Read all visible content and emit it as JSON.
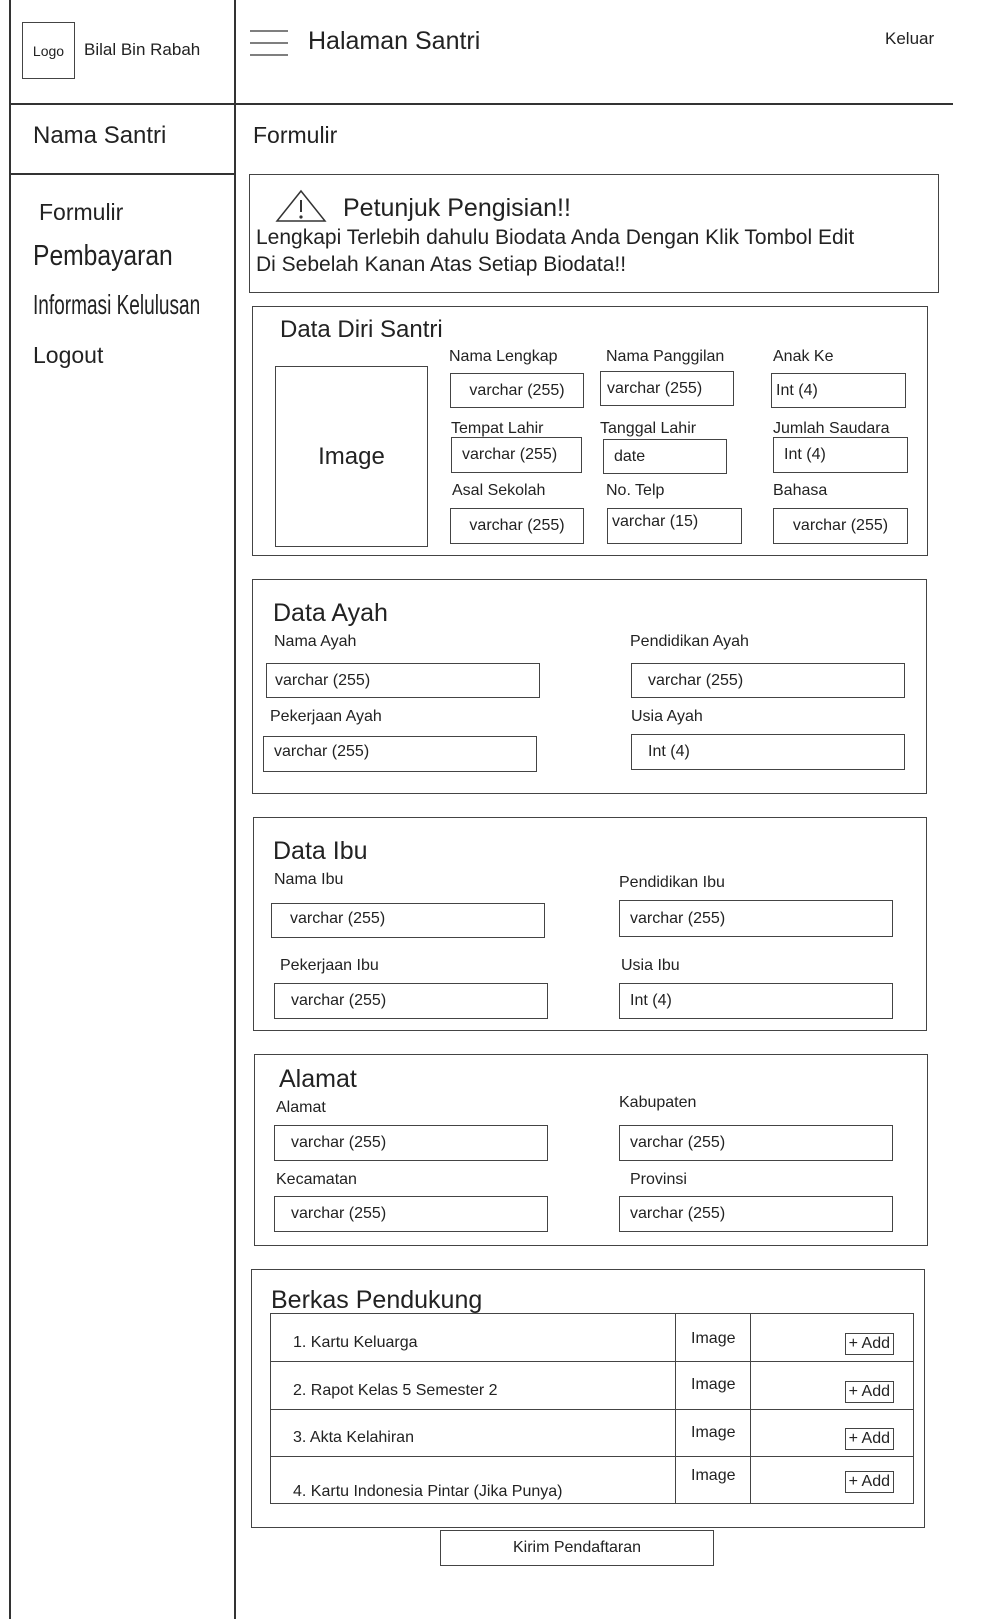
{
  "header": {
    "logo": "Logo",
    "brand": "Bilal Bin Rabah",
    "menu_icon": "hamburger-menu-icon",
    "page_title": "Halaman Santri",
    "logout_link": "Keluar"
  },
  "sidebar": {
    "user_name": "Nama Santri",
    "items": [
      {
        "label": "Formulir"
      },
      {
        "label": "Pembayaran"
      },
      {
        "label": "Informasi Kelulusan"
      },
      {
        "label": "Logout"
      }
    ]
  },
  "main": {
    "title": "Formulir",
    "notice": {
      "icon": "warning-triangle-icon",
      "heading": "Petunjuk Pengisian!!",
      "line1": "Lengkapi Terlebih dahulu Biodata Anda Dengan Klik Tombol Edit",
      "line2": "Di Sebelah Kanan Atas Setiap Biodata!!"
    },
    "data_diri": {
      "title": "Data Diri Santri",
      "photo": "Image",
      "fields": [
        {
          "label": "Nama Lengkap",
          "value": "varchar (255)"
        },
        {
          "label": "Nama Panggilan",
          "value": "varchar (255)"
        },
        {
          "label": "Anak Ke",
          "value": "Int (4)"
        },
        {
          "label": "Tempat Lahir",
          "value": "varchar (255)"
        },
        {
          "label": "Tanggal Lahir",
          "value": "date"
        },
        {
          "label": "Jumlah Saudara",
          "value": "Int (4)"
        },
        {
          "label": "Asal Sekolah",
          "value": "varchar (255)"
        },
        {
          "label": "No. Telp",
          "value": "varchar (15)"
        },
        {
          "label": "Bahasa",
          "value": "varchar (255)"
        }
      ]
    },
    "data_ayah": {
      "title": "Data Ayah",
      "fields": [
        {
          "label": "Nama Ayah",
          "value": "varchar (255)"
        },
        {
          "label": "Pendidikan Ayah",
          "value": "varchar (255)"
        },
        {
          "label": "Pekerjaan Ayah",
          "value": "varchar (255)"
        },
        {
          "label": "Usia Ayah",
          "value": "Int (4)"
        }
      ]
    },
    "data_ibu": {
      "title": "Data Ibu",
      "fields": [
        {
          "label": "Nama Ibu",
          "value": "varchar (255)"
        },
        {
          "label": "Pendidikan Ibu",
          "value": "varchar (255)"
        },
        {
          "label": "Pekerjaan Ibu",
          "value": "varchar (255)"
        },
        {
          "label": "Usia Ibu",
          "value": "Int (4)"
        }
      ]
    },
    "alamat": {
      "title": "Alamat",
      "fields": [
        {
          "label": "Alamat",
          "value": "varchar (255)"
        },
        {
          "label": "Kabupaten",
          "value": "varchar (255)"
        },
        {
          "label": "Kecamatan",
          "value": "varchar (255)"
        },
        {
          "label": "Provinsi",
          "value": "varchar (255)"
        }
      ]
    },
    "berkas": {
      "title": "Berkas Pendukung",
      "rows": [
        {
          "name": "1. Kartu Keluarga",
          "type": "Image",
          "action": "+ Add"
        },
        {
          "name": "2. Rapot Kelas 5 Semester 2",
          "type": "Image",
          "action": "+ Add"
        },
        {
          "name": "3. Akta Kelahiran",
          "type": "Image",
          "action": "+ Add"
        },
        {
          "name": "4. Kartu Indonesia Pintar (Jika Punya)",
          "type": "Image",
          "action": "+ Add"
        }
      ]
    },
    "submit_label": "Kirim Pendaftaran"
  }
}
